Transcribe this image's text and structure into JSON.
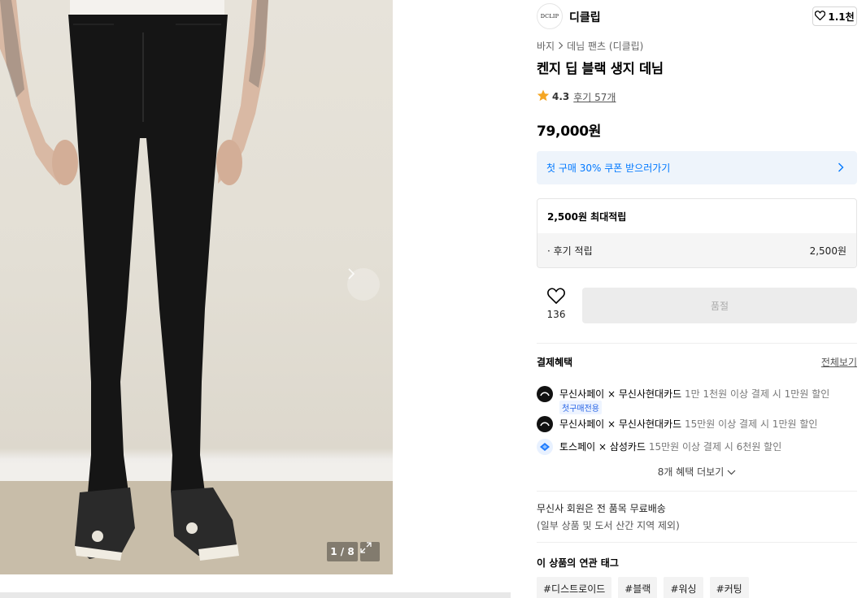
{
  "gallery": {
    "counter": "1 / 8",
    "next_icon": "chevron-right-icon",
    "expand_icon": "expand-icon"
  },
  "brand": {
    "logo_text": "DCLIP",
    "name": "디클립",
    "likes": "1.1천",
    "like_icon": "heart-icon"
  },
  "breadcrumb": {
    "category": "바지",
    "subcategory": "데님 팬츠 (디클립)",
    "separator_icon": "chevron-right-icon"
  },
  "product": {
    "title": "켄지 딥 블랙 생지 데님",
    "rating": "4.3",
    "reviews": "후기 57개",
    "price": "79,000원",
    "star_color": "#f5a623"
  },
  "coupon": {
    "text": "첫 구매 30% 쿠폰 받으러가기",
    "accent": "#0078ff"
  },
  "points": {
    "max_label": "2,500원 최대적립",
    "row_label": "· 후기 적립",
    "row_value": "2,500원"
  },
  "actions": {
    "wish_count": "136",
    "soldout_label": "품절"
  },
  "benefits": {
    "title": "결제혜택",
    "see_all": "전체보기",
    "items": [
      {
        "name": "무신사페이 × 무신사현대카드",
        "desc": "1만 1천원 이상 결제 시 1만원 할인",
        "tag": "첫구매전용",
        "icon": "musinsa-pay-icon"
      },
      {
        "name": "무신사페이 × 무신사현대카드",
        "desc": "15만원 이상 결제 시 1만원 할인",
        "tag": "",
        "icon": "musinsa-pay-icon"
      },
      {
        "name": "토스페이 × 삼성카드",
        "desc": "15만원 이상 결제 시 6천원 할인",
        "tag": "",
        "icon": "toss-pay-icon"
      }
    ],
    "more": "8개 혜택 더보기"
  },
  "shipping": {
    "line1": "무신사 회원은 전 품목 무료배송",
    "line2": "(일부 상품 및 도서 산간 지역 제외)"
  },
  "related_tags": {
    "title": "이 상품의 연관 태그",
    "items": [
      "#디스트로이드",
      "#블랙",
      "#워싱",
      "#커팅"
    ]
  }
}
